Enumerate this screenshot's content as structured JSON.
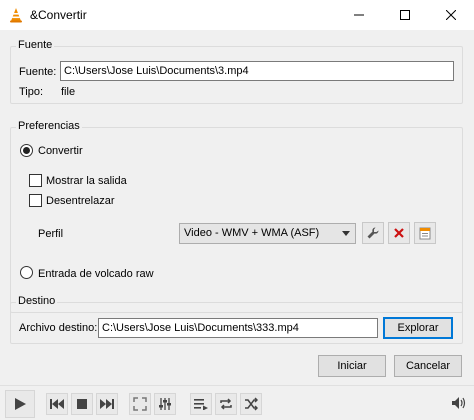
{
  "window": {
    "title": "&Convertir"
  },
  "source": {
    "group_label": "Fuente",
    "source_label": "Fuente:",
    "source_value": "C:\\Users\\Jose Luis\\Documents\\3.mp4",
    "type_label": "Tipo:",
    "type_value": "file"
  },
  "preferences": {
    "group_label": "Preferencias",
    "convert_label": "Convertir",
    "convert_selected": true,
    "show_output_label": "Mostrar la salida",
    "show_output_checked": false,
    "deinterlace_label": "Desentrelazar",
    "deinterlace_checked": false,
    "profile_label": "Perfil",
    "profile_value": "Video - WMV + WMA (ASF)",
    "raw_dump_label": "Entrada de volcado raw",
    "raw_dump_selected": false
  },
  "destination": {
    "group_label": "Destino",
    "dest_label": "Archivo destino:",
    "dest_value": "C:\\Users\\Jose Luis\\Documents\\333.mp4",
    "browse_label": "Explorar"
  },
  "actions": {
    "start_label": "Iniciar",
    "cancel_label": "Cancelar"
  },
  "colors": {
    "delete_red": "#cc1111",
    "focus_blue": "#0078d7",
    "vlc_orange": "#f08c00"
  },
  "icons": {
    "profile_edit": "wrench-icon",
    "profile_delete": "delete-icon",
    "profile_new": "new-profile-icon",
    "toolbar": [
      "play-icon",
      "previous-icon",
      "stop-icon",
      "next-icon",
      "fullscreen-icon",
      "extended-settings-icon",
      "playlist-icon",
      "loop-icon",
      "shuffle-icon",
      "volume-icon"
    ]
  }
}
